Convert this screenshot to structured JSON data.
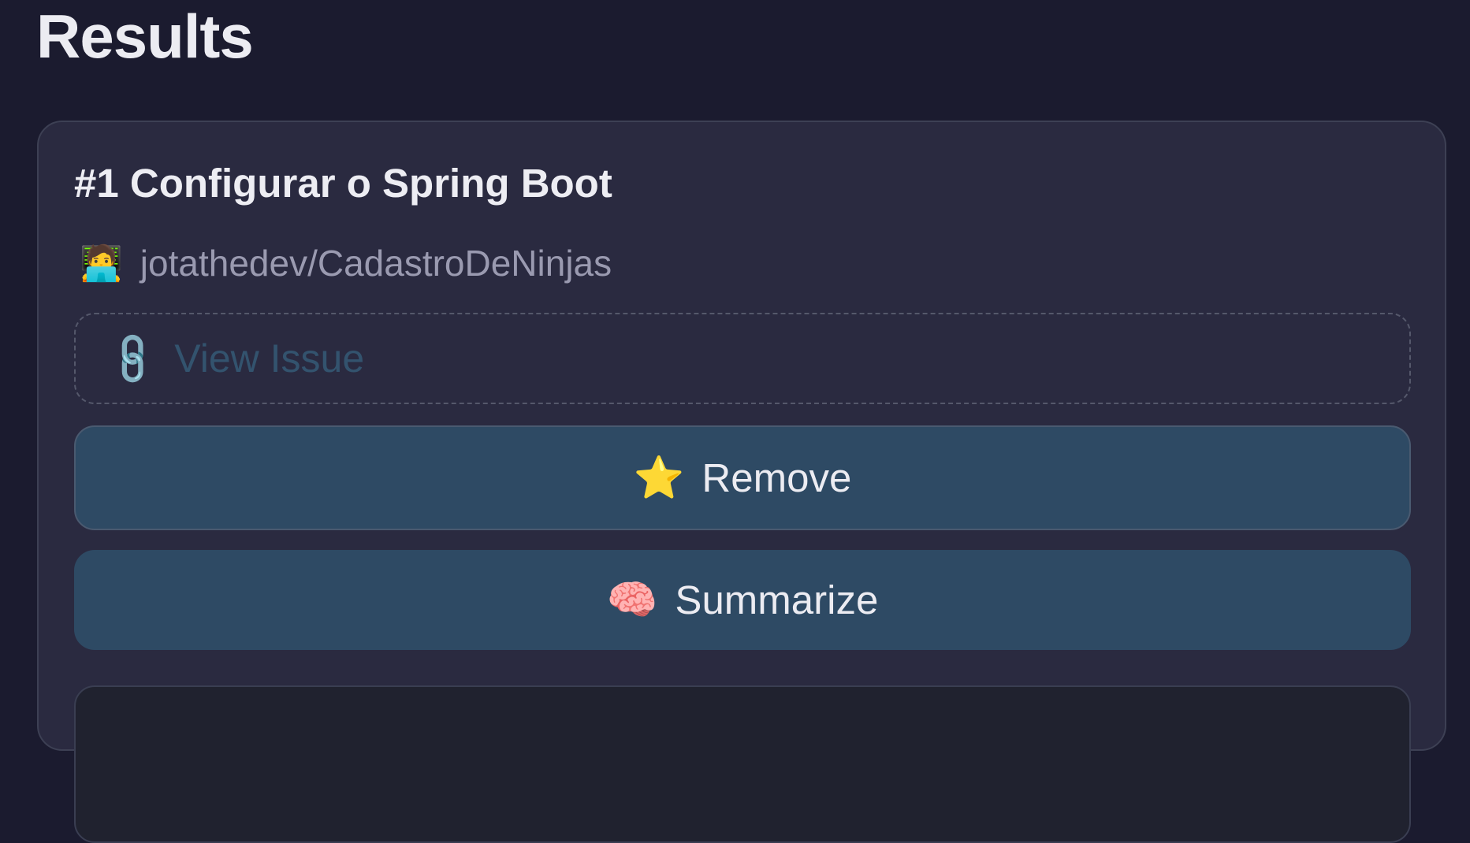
{
  "page": {
    "title": "Results"
  },
  "result": {
    "title": "#1 Configurar o Spring Boot",
    "repo_icon": "🧑‍💻",
    "repo": "jotathedev/CadastroDeNinjas",
    "view_link_icon": "🔗",
    "view_link_label": "View Issue",
    "remove_icon": "⭐",
    "remove_label": "Remove",
    "summarize_icon": "🧠",
    "summarize_label": "Summarize"
  },
  "colors": {
    "background": "#1b1b2f",
    "card": "#2a2a40",
    "button": "#2e4a64",
    "link_text": "#33536e",
    "muted_text": "#9a9ab0"
  }
}
